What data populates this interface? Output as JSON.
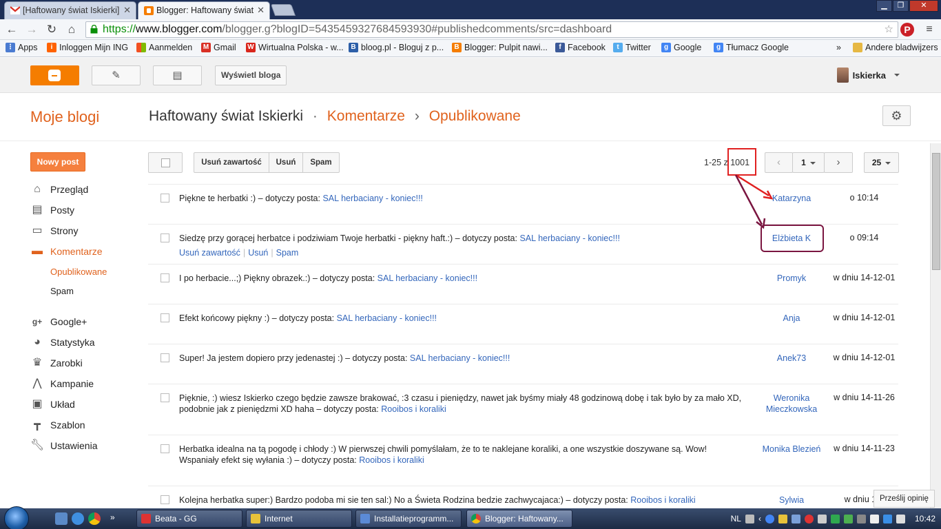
{
  "browser": {
    "tabs": [
      {
        "title": "[Haftowany świat Iskierki]",
        "icon": "gmail-icon"
      },
      {
        "title": "Blogger: Haftowany świat",
        "icon": "blogger-icon"
      }
    ],
    "url": {
      "scheme": "https://",
      "host": "www.blogger.com",
      "path": "/blogger.g?blogID=5435459327684593930#publishedcomments/src=dashboard"
    },
    "bookmarks": [
      {
        "label": "Apps",
        "color": "#4a7bd1"
      },
      {
        "label": "Inloggen Mijn ING",
        "color": "#ff6200"
      },
      {
        "label": "Aanmelden",
        "color": "#d83b01"
      },
      {
        "label": "Gmail",
        "color": "#d93025"
      },
      {
        "label": "Wirtualna Polska - w...",
        "color": "#d9261c"
      },
      {
        "label": "bloog.pl - Bloguj z p...",
        "color": "#2d5fa8"
      },
      {
        "label": "Blogger: Pulpit nawi...",
        "color": "#f57d00"
      },
      {
        "label": "Facebook",
        "color": "#3b5998"
      },
      {
        "label": "Twitter",
        "color": "#55acee"
      },
      {
        "label": "Google",
        "color": "#4285f4"
      },
      {
        "label": "Tłumacz Google",
        "color": "#4285f4"
      }
    ],
    "bookmarks_overflow": "»",
    "other_bookmarks": "Andere bladwijzers"
  },
  "header": {
    "view_blog_label": "Wyświetl bloga",
    "user_name": "Iskierka"
  },
  "title": {
    "my_blogs": "Moje blogi",
    "blog_name": "Haftowany świat Iskierki",
    "dot": "·",
    "section": "Komentarze",
    "arrow": "›",
    "subsection": "Opublikowane"
  },
  "sidebar": {
    "new_post": "Nowy post",
    "items": [
      {
        "label": "Przegląd",
        "icon": "home-icon"
      },
      {
        "label": "Posty",
        "icon": "posts-icon"
      },
      {
        "label": "Strony",
        "icon": "pages-icon"
      },
      {
        "label": "Komentarze",
        "icon": "comment-icon"
      },
      {
        "label": "Opublikowane"
      },
      {
        "label": "Spam"
      },
      {
        "label": "Google+",
        "icon": "google-plus-icon"
      },
      {
        "label": "Statystyka",
        "icon": "stats-icon"
      },
      {
        "label": "Zarobki",
        "icon": "trophy-icon"
      },
      {
        "label": "Kampanie",
        "icon": "campaign-icon"
      },
      {
        "label": "Układ",
        "icon": "layout-icon"
      },
      {
        "label": "Szablon",
        "icon": "template-icon"
      },
      {
        "label": "Ustawienia",
        "icon": "wrench-icon"
      }
    ]
  },
  "actions": {
    "remove_content": "Usuń zawartość",
    "delete": "Usuń",
    "spam": "Spam"
  },
  "pager": {
    "range": "1-25 z",
    "total": "1001",
    "page": "1",
    "per_page": "25"
  },
  "comments": [
    {
      "text": "Piękne te herbatki :) – dotyczy posta: ",
      "post": "SAL herbaciany - koniec!!!",
      "author": "Katarzyna",
      "date": "o 10:14"
    },
    {
      "text": "Siedzę przy gorącej herbatce i podziwiam Twoje herbatki - piękny haft.:) – dotyczy posta: ",
      "post": "SAL herbaciany - koniec!!!",
      "author": "Elżbieta K",
      "date": "o 09:14",
      "actions": [
        "Usuń zawartość",
        "Usuń",
        "Spam"
      ]
    },
    {
      "text": "I po herbacie...;) Piękny obrazek.:) – dotyczy posta: ",
      "post": "SAL herbaciany - koniec!!!",
      "author": "Promyk",
      "date": "w dniu 14-12-01"
    },
    {
      "text": "Efekt końcowy piękny :) – dotyczy posta: ",
      "post": "SAL herbaciany - koniec!!!",
      "author": "Anja",
      "date": "w dniu 14-12-01"
    },
    {
      "text": "Super! Ja jestem dopiero przy jedenastej :) – dotyczy posta: ",
      "post": "SAL herbaciany - koniec!!!",
      "author": "Anek73",
      "date": "w dniu 14-12-01"
    },
    {
      "text": "Pięknie, :) wiesz Iskierko czego będzie zawsze brakować, :3 czasu i pieniędzy, nawet jak byśmy miały 48 godzinową dobę i tak było by za mało XD, podobnie jak z pieniędzmi XD haha – dotyczy posta: ",
      "post": "Rooibos i koraliki",
      "author": "Weronika Mieczkowska",
      "date": "w dniu 14-11-26"
    },
    {
      "text": "Herbatka idealna na tą pogodę i chłody :) W pierwszej chwili pomyślałam, że to te naklejane koraliki, a one wszystkie doszywane są. Wow! Wspaniały efekt się wyłania :) – dotyczy posta: ",
      "post": "Rooibos i koraliki",
      "author": "Monika Blezień",
      "date": "w dniu 14-11-23"
    },
    {
      "text": "Kolejna herbatka super:) Bardzo podoba mi sie ten sal:) No a Świeta Rodzina bedzie zachwycajaca:) – dotyczy posta: ",
      "post": "Rooibos i koraliki",
      "author": "Sylwia",
      "date": "w dniu 14-"
    }
  ],
  "feedback": "Prześlij opinię",
  "taskbar": {
    "tasks": [
      {
        "label": "Beata - GG",
        "color": "#d33"
      },
      {
        "label": "Internet",
        "color": "#e7c23a"
      },
      {
        "label": "Installatieprogramm...",
        "color": "#5b8ad6"
      },
      {
        "label": "Blogger: Haftowany...",
        "color": "#f57d00"
      }
    ],
    "lang": "NL",
    "clock": "10:42"
  }
}
